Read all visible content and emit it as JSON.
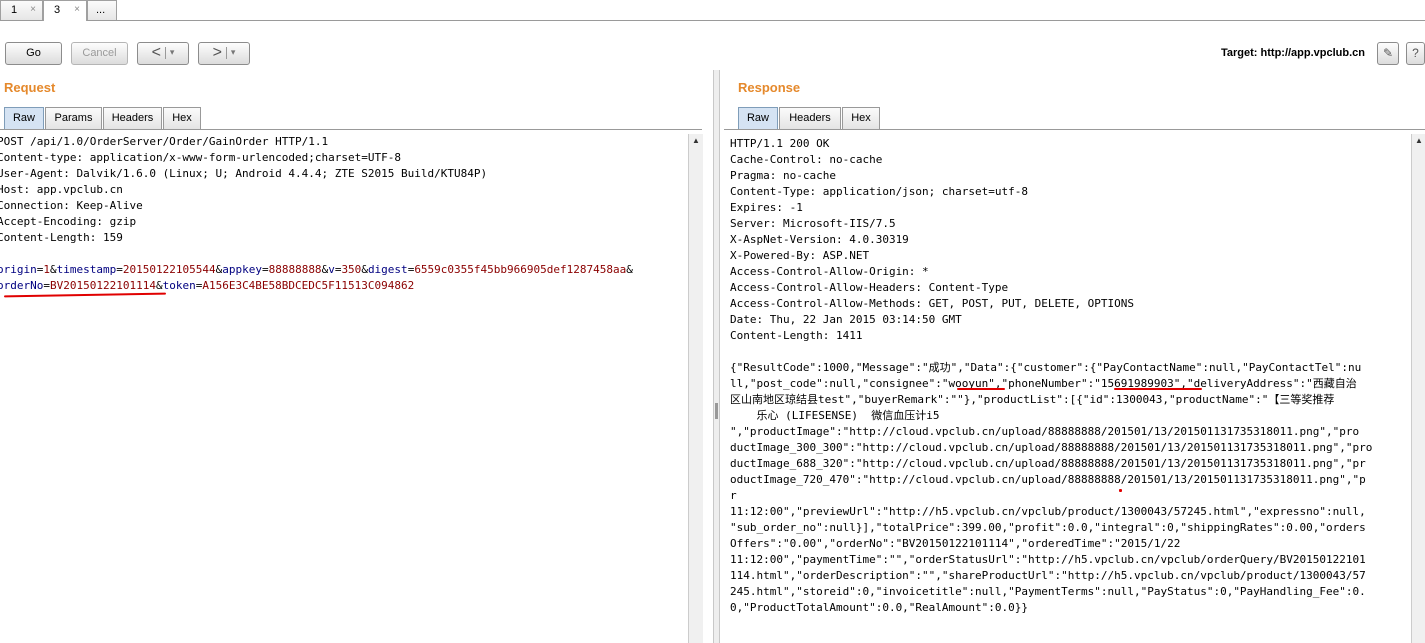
{
  "tabs": [
    {
      "label": "1",
      "close": "×"
    },
    {
      "label": "3",
      "close": "×"
    },
    {
      "label": "..."
    }
  ],
  "toolbar": {
    "go_label": "Go",
    "cancel_label": "Cancel",
    "back_label": "<",
    "forward_label": ">",
    "dropdown_glyph": "▾",
    "target_text": "Target: http://app.vpclub.cn",
    "edit_icon": "pencil-icon",
    "help_icon": "question-icon",
    "help_glyph": "?",
    "edit_glyph": "✎"
  },
  "request": {
    "title": "Request",
    "tabs": [
      "Raw",
      "Params",
      "Headers",
      "Hex"
    ],
    "headers": [
      "POST /api/1.0/OrderServer/Order/GainOrder HTTP/1.1",
      "Content-type: application/x-www-form-urlencoded;charset=UTF-8",
      "User-Agent: Dalvik/1.6.0 (Linux; U; Android 4.4.4; ZTE S2015 Build/KTU84P)",
      "Host: app.vpclub.cn",
      "Connection: Keep-Alive",
      "Accept-Encoding: gzip",
      "Content-Length: 159"
    ],
    "params_line1": [
      {
        "k": "origin",
        "v": "1"
      },
      {
        "k": "timestamp",
        "v": "20150122105544"
      },
      {
        "k": "appkey",
        "v": "88888888"
      },
      {
        "k": "v",
        "v": "350"
      },
      {
        "k": "digest",
        "v": "6559c0355f45bb966905def1287458aa"
      }
    ],
    "params_line2": [
      {
        "k": "orderNo",
        "v": "BV20150122101114"
      },
      {
        "k": "token",
        "v": "A156E3C4BE58BDCEDC5F11513C094862"
      }
    ]
  },
  "response": {
    "title": "Response",
    "tabs": [
      "Raw",
      "Headers",
      "Hex"
    ],
    "headers": [
      "HTTP/1.1 200 OK",
      "Cache-Control: no-cache",
      "Pragma: no-cache",
      "Content-Type: application/json; charset=utf-8",
      "Expires: -1",
      "Server: Microsoft-IIS/7.5",
      "X-AspNet-Version: 4.0.30319",
      "X-Powered-By: ASP.NET",
      "Access-Control-Allow-Origin: *",
      "Access-Control-Allow-Headers: Content-Type",
      "Access-Control-Allow-Methods: GET, POST, PUT, DELETE, OPTIONS",
      "Date: Thu, 22 Jan 2015 03:14:50 GMT",
      "Content-Length: 1411"
    ],
    "body_lines": [
      "{\"ResultCode\":1000,\"Message\":\"成功\",\"Data\":{\"customer\":{\"PayContactName\":null,\"PayContactTel\":nu",
      "ll,\"post_code\":null,\"consignee\":\"wooyun\",\"phoneNumber\":\"15691989903\",\"deliveryAddress\":\"西藏自治",
      "区山南地区琼结县test\",\"buyerRemark\":\"\"},\"productList\":[{\"id\":1300043,\"productName\":\"【三等奖推荐",
      "    乐心 (LIFESENSE)  微信血压计i5",
      "\",\"productImage\":\"http://cloud.vpclub.cn/upload/88888888/201501/13/201501131735318011.png\",\"pro",
      "ductImage_300_300\":\"http://cloud.vpclub.cn/upload/88888888/201501/13/201501131735318011.png\",\"pro",
      "ductImage_688_320\":\"http://cloud.vpclub.cn/upload/88888888/201501/13/201501131735318011.png\",\"pr",
      "oductImage_720_470\":\"http://cloud.vpclub.cn/upload/88888888/201501/13/201501131735318011.png\",\"p",
      "r",
      "11:12:00\",\"previewUrl\":\"http://h5.vpclub.cn/vpclub/product/1300043/57245.html\",\"expressno\":null,",
      "\"sub_order_no\":null}],\"totalPrice\":399.00,\"profit\":0.0,\"integral\":0,\"shippingRates\":0.00,\"orders",
      "Offers\":\"0.00\",\"orderNo\":\"BV20150122101114\",\"orderedTime\":\"2015/1/22",
      "11:12:00\",\"paymentTime\":\"\",\"orderStatusUrl\":\"http://h5.vpclub.cn/vpclub/orderQuery/BV20150122101",
      "114.html\",\"orderDescription\":\"\",\"shareProductUrl\":\"http://h5.vpclub.cn/vpclub/product/1300043/57",
      "245.html\",\"storeid\":0,\"invoicetitle\":null,\"PaymentTerms\":null,\"PayStatus\":0,\"PayHandling_Fee\":0.",
      "0,\"ProductTotalAmount\":0.0,\"RealAmount\":0.0}}"
    ]
  }
}
